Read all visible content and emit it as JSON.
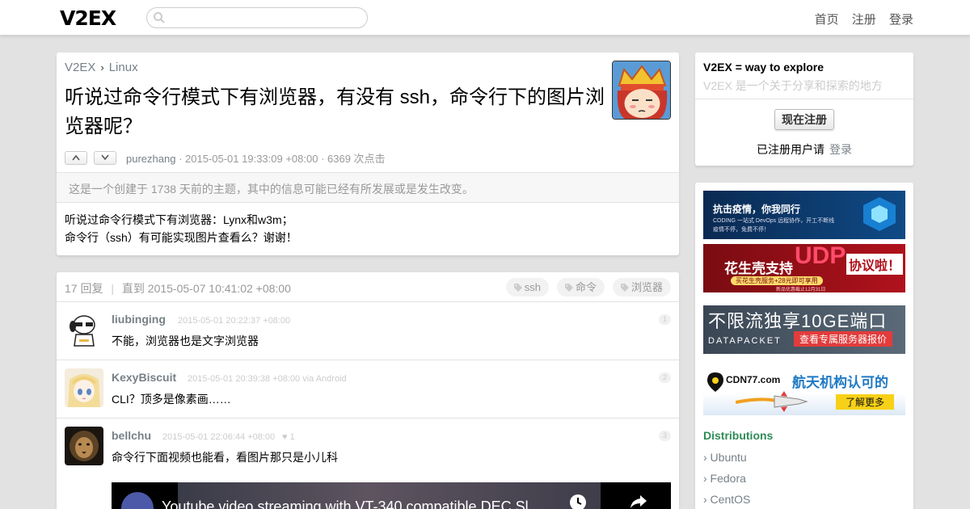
{
  "header": {
    "logo": "V2EX",
    "search_placeholder": "",
    "nav": [
      "首页",
      "注册",
      "登录"
    ]
  },
  "topic": {
    "breadcrumb": [
      "V2EX",
      "Linux"
    ],
    "breadcrumb_sep": "›",
    "title": "听说过命令行模式下有浏览器，有没有 ssh，命令行下的图片浏览器呢？",
    "author": "purezhang",
    "time": " · 2015-05-01 19:33:09 +08:00 · 6369 次点击",
    "notice": "这是一个创建于 1738 天前的主题，其中的信息可能已经有所发展或是发生改变。",
    "content": [
      "听说过命令行模式下有浏览器：Lynx和w3m；",
      "命令行（ssh）有可能实现图片查看么？谢谢！"
    ]
  },
  "replies_box": {
    "count": "17 回复",
    "divider": "|",
    "until": "直到 2015-05-07 10:41:02 +08:00",
    "tags": [
      "ssh",
      "命令",
      "浏览器"
    ],
    "replies": [
      {
        "name": "liubinging",
        "time": "2015-05-01 20:22:37 +08:00",
        "text": "不能，浏览器也是文字浏览器",
        "no": "1"
      },
      {
        "name": "KexyBiscuit",
        "time": "2015-05-01 20:39:38 +08:00 via Android",
        "text": "CLI？顶多是像素画……",
        "no": "2"
      },
      {
        "name": "bellchu",
        "time": "2015-05-01 22:06:44 +08:00",
        "likes": "♥ 1",
        "text": "命令行下面视频也能看，看图片那只是小儿科",
        "no": "3"
      }
    ],
    "video_title": "Youtube video streaming with VT-340 compatible DEC Sl..."
  },
  "sidebar": {
    "title": "V2EX = way to explore",
    "subtitle": "V2EX 是一个关于分享和探索的地方",
    "signup": "现在注册",
    "registered": "已注册用户请",
    "login": "登录",
    "ads": [
      {
        "line1": "抗击疫情，你我同行",
        "line2": "CODING 一站式 DevOps 远程协作，开工不断线",
        "line3": "疫情不停，免费不停！"
      },
      {
        "line1": "花生壳支持",
        "line2": "UDP",
        "line3": "协议啦！",
        "line4": "买花生壳服务+28元即可享用",
        "line5": "新品优惠截止12月31日"
      },
      {
        "line1": "不限流独享10GE端口",
        "line2": "DATAPACKET",
        "line3": "查看专属服务器报价"
      },
      {
        "line1": "CDN77.com",
        "line2": "航天机构认可的",
        "line3": "了解更多"
      }
    ],
    "dist_title": "Distributions",
    "distributions": [
      "› Ubuntu",
      "› Fedora",
      "› CentOS"
    ]
  }
}
